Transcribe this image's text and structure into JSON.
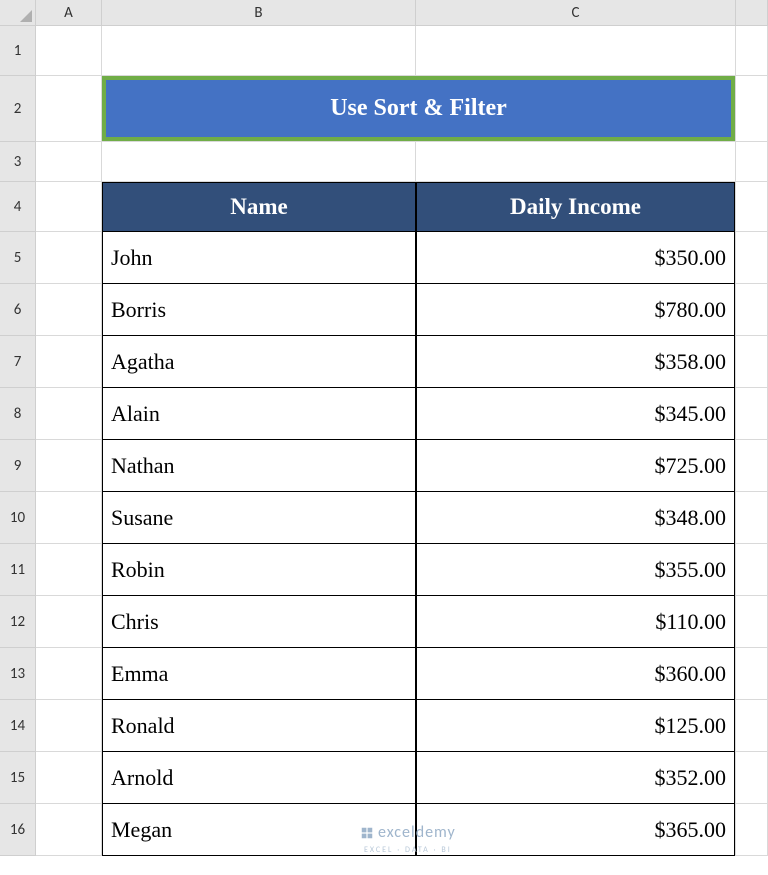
{
  "columns": [
    "A",
    "B",
    "C"
  ],
  "row_numbers": [
    "1",
    "2",
    "3",
    "4",
    "5",
    "6",
    "7",
    "8",
    "9",
    "10",
    "11",
    "12",
    "13",
    "14",
    "15",
    "16"
  ],
  "title": "Use Sort & Filter",
  "table": {
    "headers": {
      "name": "Name",
      "income": "Daily Income"
    },
    "rows": [
      {
        "name": "John",
        "income": "$350.00"
      },
      {
        "name": "Borris",
        "income": "$780.00"
      },
      {
        "name": "Agatha",
        "income": "$358.00"
      },
      {
        "name": "Alain",
        "income": "$345.00"
      },
      {
        "name": "Nathan",
        "income": "$725.00"
      },
      {
        "name": "Susane",
        "income": "$348.00"
      },
      {
        "name": "Robin",
        "income": "$355.00"
      },
      {
        "name": "Chris",
        "income": "$110.00"
      },
      {
        "name": "Emma",
        "income": "$360.00"
      },
      {
        "name": "Ronald",
        "income": "$125.00"
      },
      {
        "name": "Arnold",
        "income": "$352.00"
      },
      {
        "name": "Megan",
        "income": "$365.00"
      }
    ]
  },
  "watermark": {
    "main": "exceldemy",
    "sub": "EXCEL · DATA · BI"
  },
  "chart_data": {
    "type": "table",
    "columns": [
      "Name",
      "Daily Income"
    ],
    "rows": [
      [
        "John",
        350.0
      ],
      [
        "Borris",
        780.0
      ],
      [
        "Agatha",
        358.0
      ],
      [
        "Alain",
        345.0
      ],
      [
        "Nathan",
        725.0
      ],
      [
        "Susane",
        348.0
      ],
      [
        "Robin",
        355.0
      ],
      [
        "Chris",
        110.0
      ],
      [
        "Emma",
        360.0
      ],
      [
        "Ronald",
        125.0
      ],
      [
        "Arnold",
        352.0
      ],
      [
        "Megan",
        365.0
      ]
    ]
  }
}
